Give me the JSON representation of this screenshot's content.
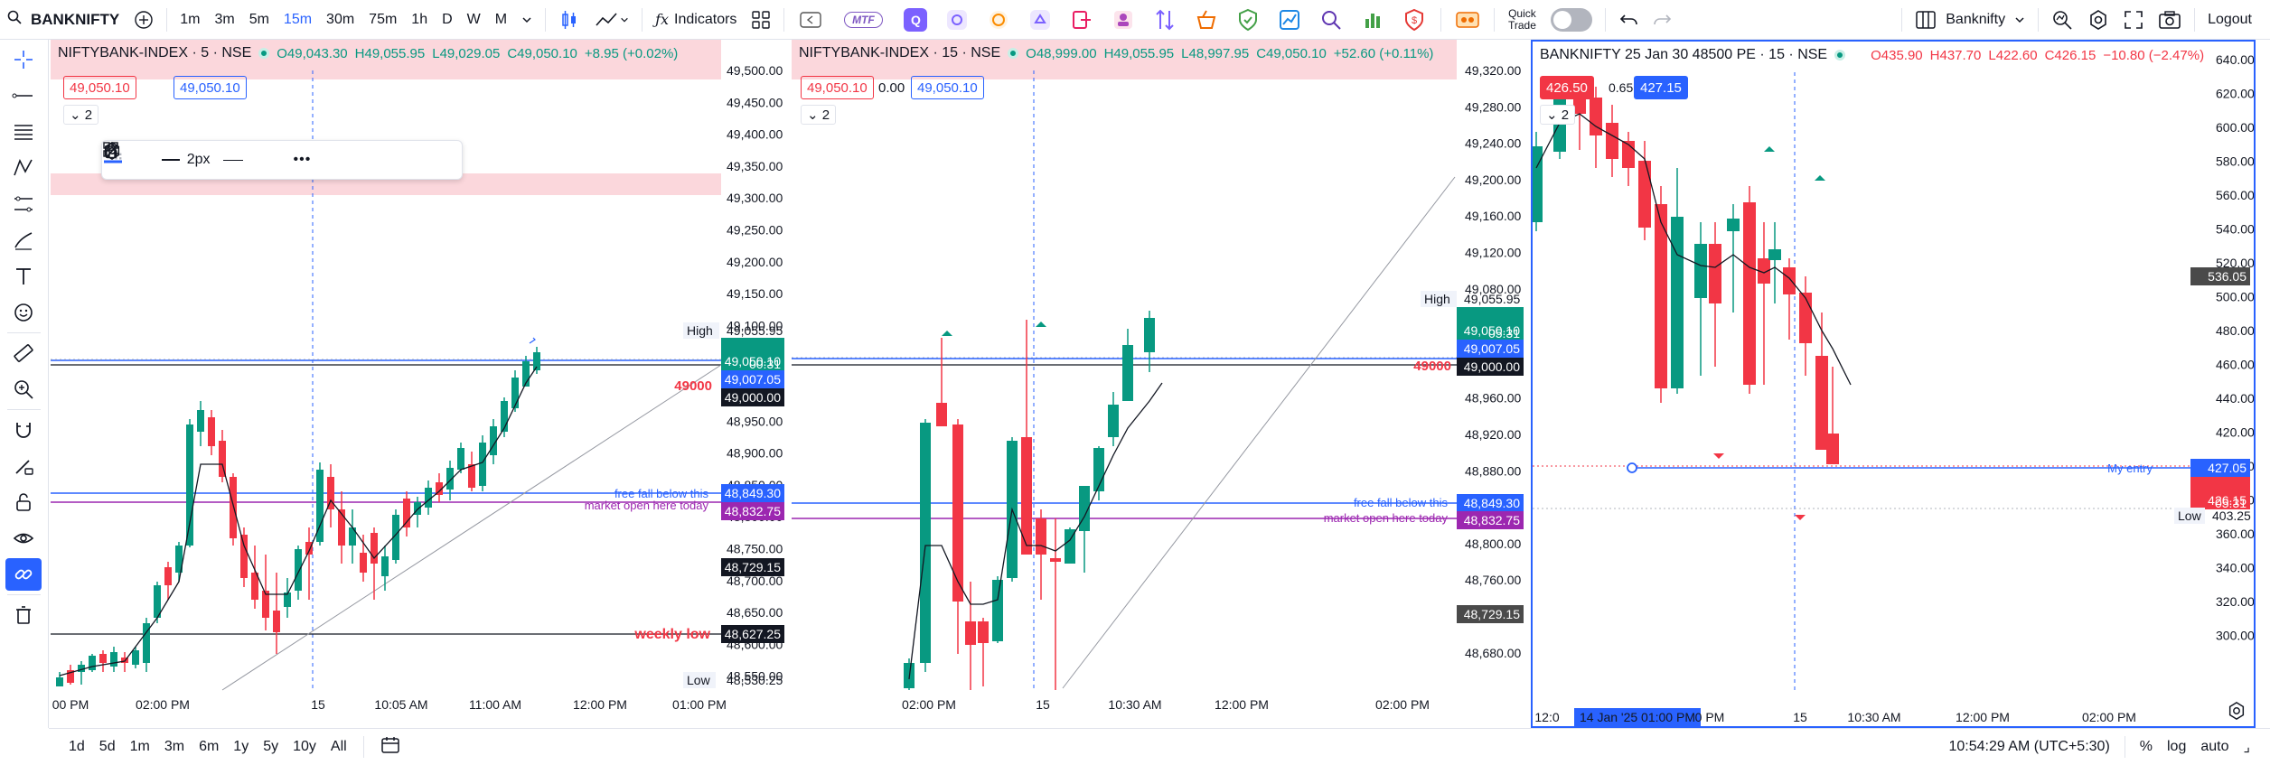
{
  "toolbar": {
    "symbol": "BANKNIFTY",
    "intervals": [
      "1m",
      "3m",
      "5m",
      "15m",
      "30m",
      "75m",
      "1h",
      "D",
      "W",
      "M"
    ],
    "active_interval": "15m",
    "indicators_label": "Indicators",
    "mtf_label": "MTF",
    "quick_trade_label": "Quick Trade",
    "layout_name": "Banknifty",
    "logout_label": "Logout"
  },
  "bottom": {
    "ranges": [
      "1d",
      "5d",
      "1m",
      "3m",
      "6m",
      "1y",
      "5y",
      "10y",
      "All"
    ],
    "clock": "10:54:29 AM (UTC+5:30)",
    "percent_label": "%",
    "log_label": "log",
    "auto_label": "auto"
  },
  "drawing_toolbar": {
    "width_label": "2px"
  },
  "panes": [
    {
      "title": "NIFTYBANK-INDEX · 5 · NSE",
      "ohlc": {
        "o": "O49,043.30",
        "h": "H49,055.95",
        "l": "L49,029.05",
        "c": "C49,050.10",
        "chg": "+8.95 (+0.02%)"
      },
      "sell": "49,050.10",
      "spread": "",
      "buy": "49,050.10",
      "count": "2",
      "price_axis": [
        "49,500.00",
        "49,450.00",
        "49,400.00",
        "49,350.00",
        "49,300.00",
        "49,250.00",
        "49,200.00",
        "49,150.00",
        "49,100.00",
        "49,050.00",
        "49,000.00",
        "48,950.00",
        "48,900.00",
        "48,850.00",
        "48,800.00",
        "48,750.00",
        "48,700.00",
        "48,650.00",
        "48,600.00",
        "48,550.00"
      ],
      "time_axis": [
        "00 PM",
        "02:00 PM",
        "15",
        "10:05 AM",
        "11:00 AM",
        "12:00 PM",
        "01:00 PM"
      ],
      "tags": {
        "high_label": "High",
        "high": "49,055.95",
        "last": "49,050.10",
        "timer": "00:31",
        "blue": "49,007.05",
        "black": "49,000.00",
        "ff": "48,849.30",
        "mo": "48,832.75",
        "gray": "48,729.15",
        "wl": "48,627.25",
        "low_label": "Low",
        "low": "48,530.25"
      },
      "annotations": {
        "level_49000": "49000",
        "free_fall": "free fall below this",
        "market_open": "market open here today",
        "weekly_low": "weekly low"
      }
    },
    {
      "title": "NIFTYBANK-INDEX · 15 · NSE",
      "ohlc": {
        "o": "O48,999.00",
        "h": "H49,055.95",
        "l": "L48,997.95",
        "c": "C49,050.10",
        "chg": "+52.60 (+0.11%)"
      },
      "sell": "49,050.10",
      "spread": "0.00",
      "buy": "49,050.10",
      "count": "2",
      "price_axis": [
        "49,320.00",
        "49,280.00",
        "49,240.00",
        "49,200.00",
        "49,160.00",
        "49,120.00",
        "49,080.00",
        "49,040.00",
        "49,000.00",
        "48,960.00",
        "48,920.00",
        "48,880.00",
        "48,840.00",
        "48,800.00",
        "48,760.00",
        "48,720.00",
        "48,680.00"
      ],
      "time_axis": [
        "02:00 PM",
        "15",
        "10:30 AM",
        "12:00 PM",
        "02:00 PM"
      ],
      "tags": {
        "high_label": "High",
        "high": "49,055.95",
        "last": "49,050.10",
        "timer": "05:31",
        "blue": "49,007.05",
        "black": "49,000.00",
        "ff": "48,849.30",
        "mo": "48,832.75",
        "gray": "48,729.15"
      },
      "annotations": {
        "level_49000": "49000",
        "free_fall": "free fall below this",
        "market_open": "market open here today"
      }
    },
    {
      "title": "BANKNIFTY 25 Jan 30 48500 PE · 15 · NSE",
      "ohlc": {
        "o": "O435.90",
        "h": "H437.70",
        "l": "L422.60",
        "c": "C426.15",
        "chg": "−10.80 (−2.47%)"
      },
      "sell": "426.50",
      "spread": "0.65",
      "buy": "427.15",
      "count": "2",
      "price_axis": [
        "640.00",
        "620.00",
        "600.00",
        "580.00",
        "560.00",
        "540.00",
        "520.00",
        "500.00",
        "480.00",
        "460.00",
        "440.00",
        "420.00",
        "400.00",
        "380.00",
        "360.00",
        "340.00",
        "320.00",
        "300.00"
      ],
      "time_axis": [
        "12:0",
        "14 Jan '25   01:00 PM",
        "0 PM",
        "15",
        "10:30 AM",
        "12:00 PM",
        "02:00 PM"
      ],
      "tags": {
        "gray": "536.05",
        "entry": "427.05",
        "last": "426.15",
        "timer": "05:31",
        "low_label": "Low",
        "low": "403.25"
      },
      "annotations": {
        "my_entry": "My entry"
      }
    }
  ],
  "colors": {
    "up": "#089981",
    "down": "#f23645",
    "accent": "#2962ff",
    "purple": "#9c27b0",
    "zone": "#ffcdd2"
  }
}
